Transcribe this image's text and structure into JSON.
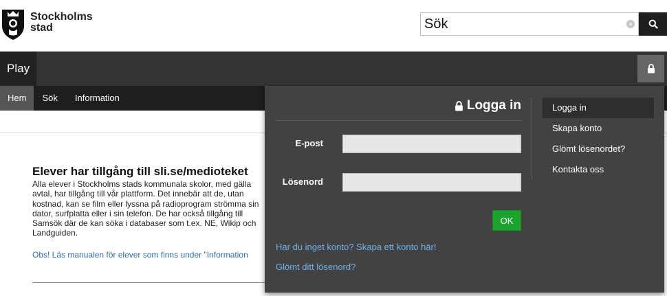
{
  "header": {
    "logo_line1": "Stockholms",
    "logo_line2": "stad",
    "search_value": "Sök",
    "clear_glyph": "×",
    "search_icon": "search-icon"
  },
  "topbar": {
    "brand": "Play",
    "lock_icon": "lock-icon"
  },
  "nav": {
    "items": [
      {
        "label": "Hem",
        "active": true
      },
      {
        "label": "Sök",
        "active": false
      },
      {
        "label": "Information",
        "active": false
      }
    ]
  },
  "content": {
    "heading": "Elever har tillgång till sli.se/medioteket",
    "paragraph": "Alla elever i Stockholms stads kommunala skolor, med gälla avtal, har tillgång till vår plattform. Det innebär att de, utan kostnad, kan se film eller lyssna på radioprogram strömma sin dator, surfplatta eller i sin telefon. De har också tillgång till Samsök där de kan söka i databaser som t.ex. NE, Wikip och Landguiden.",
    "notice_link": "Obs! Läs manualen för elever som finns under \"Information"
  },
  "login": {
    "title": "Logga in",
    "email_label": "E-post",
    "password_label": "Lösenord",
    "ok_label": "OK",
    "create_account_link": "Har du inget konto? Skapa ett konto här!",
    "forgot_password_link": "Glömt ditt lösenord?",
    "side_menu": [
      {
        "label": "Logga in",
        "active": true
      },
      {
        "label": "Skapa konto",
        "active": false
      },
      {
        "label": "Glömt lösenordet?",
        "active": false
      },
      {
        "label": "Kontakta oss",
        "active": false
      }
    ]
  },
  "colors": {
    "topbar": "#333333",
    "nav": "#1e1e1e",
    "dropdown": "#424242",
    "ok_button": "#1ca32e",
    "link": "#6fb3ec"
  }
}
